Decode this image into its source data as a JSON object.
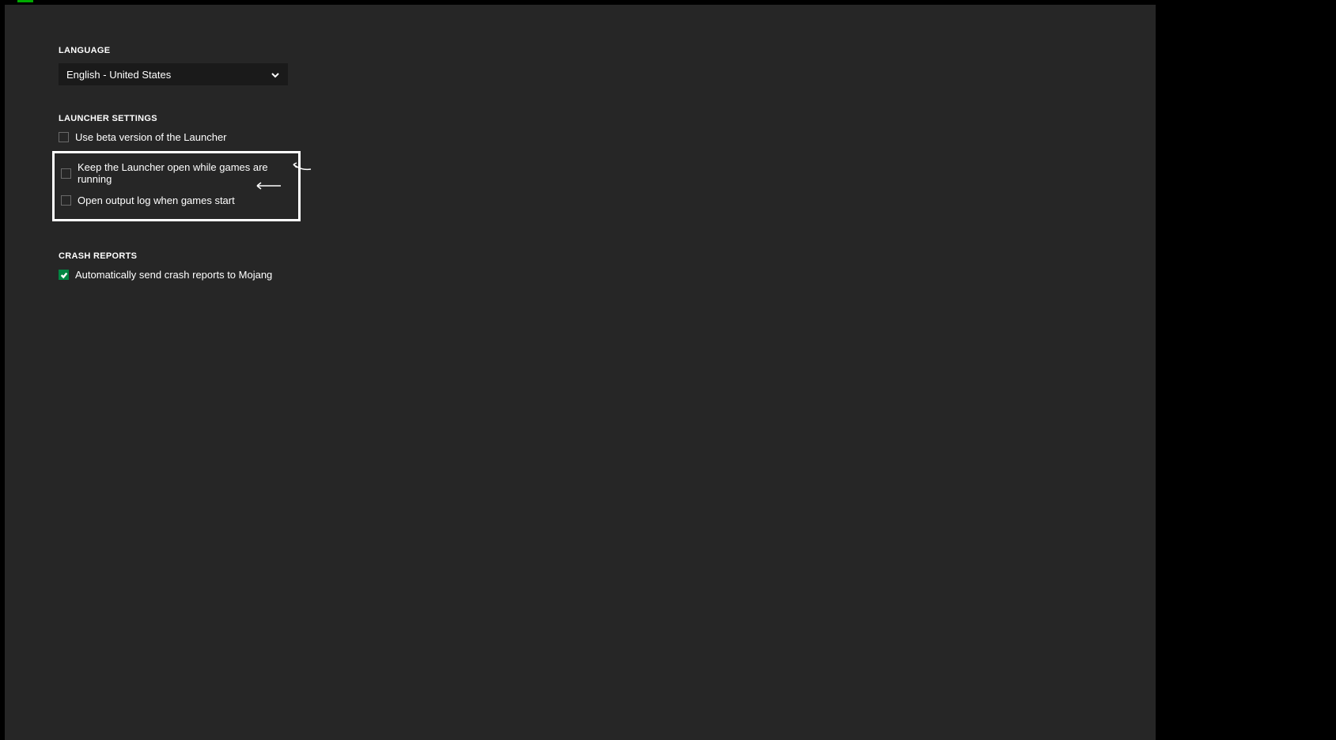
{
  "colors": {
    "accent_green": "#008542",
    "top_accent": "#00aa00",
    "bg_panel": "#262626",
    "bg_dropdown": "#1a1a1a"
  },
  "language": {
    "heading": "LANGUAGE",
    "selected": "English - United States"
  },
  "launcher_settings": {
    "heading": "LAUNCHER SETTINGS",
    "options": [
      {
        "label": "Use beta version of the Launcher",
        "checked": false
      },
      {
        "label": "Keep the Launcher open while games are running",
        "checked": false
      },
      {
        "label": "Open output log when games start",
        "checked": false
      }
    ]
  },
  "crash_reports": {
    "heading": "CRASH REPORTS",
    "options": [
      {
        "label": "Automatically send crash reports to Mojang",
        "checked": true
      }
    ]
  }
}
